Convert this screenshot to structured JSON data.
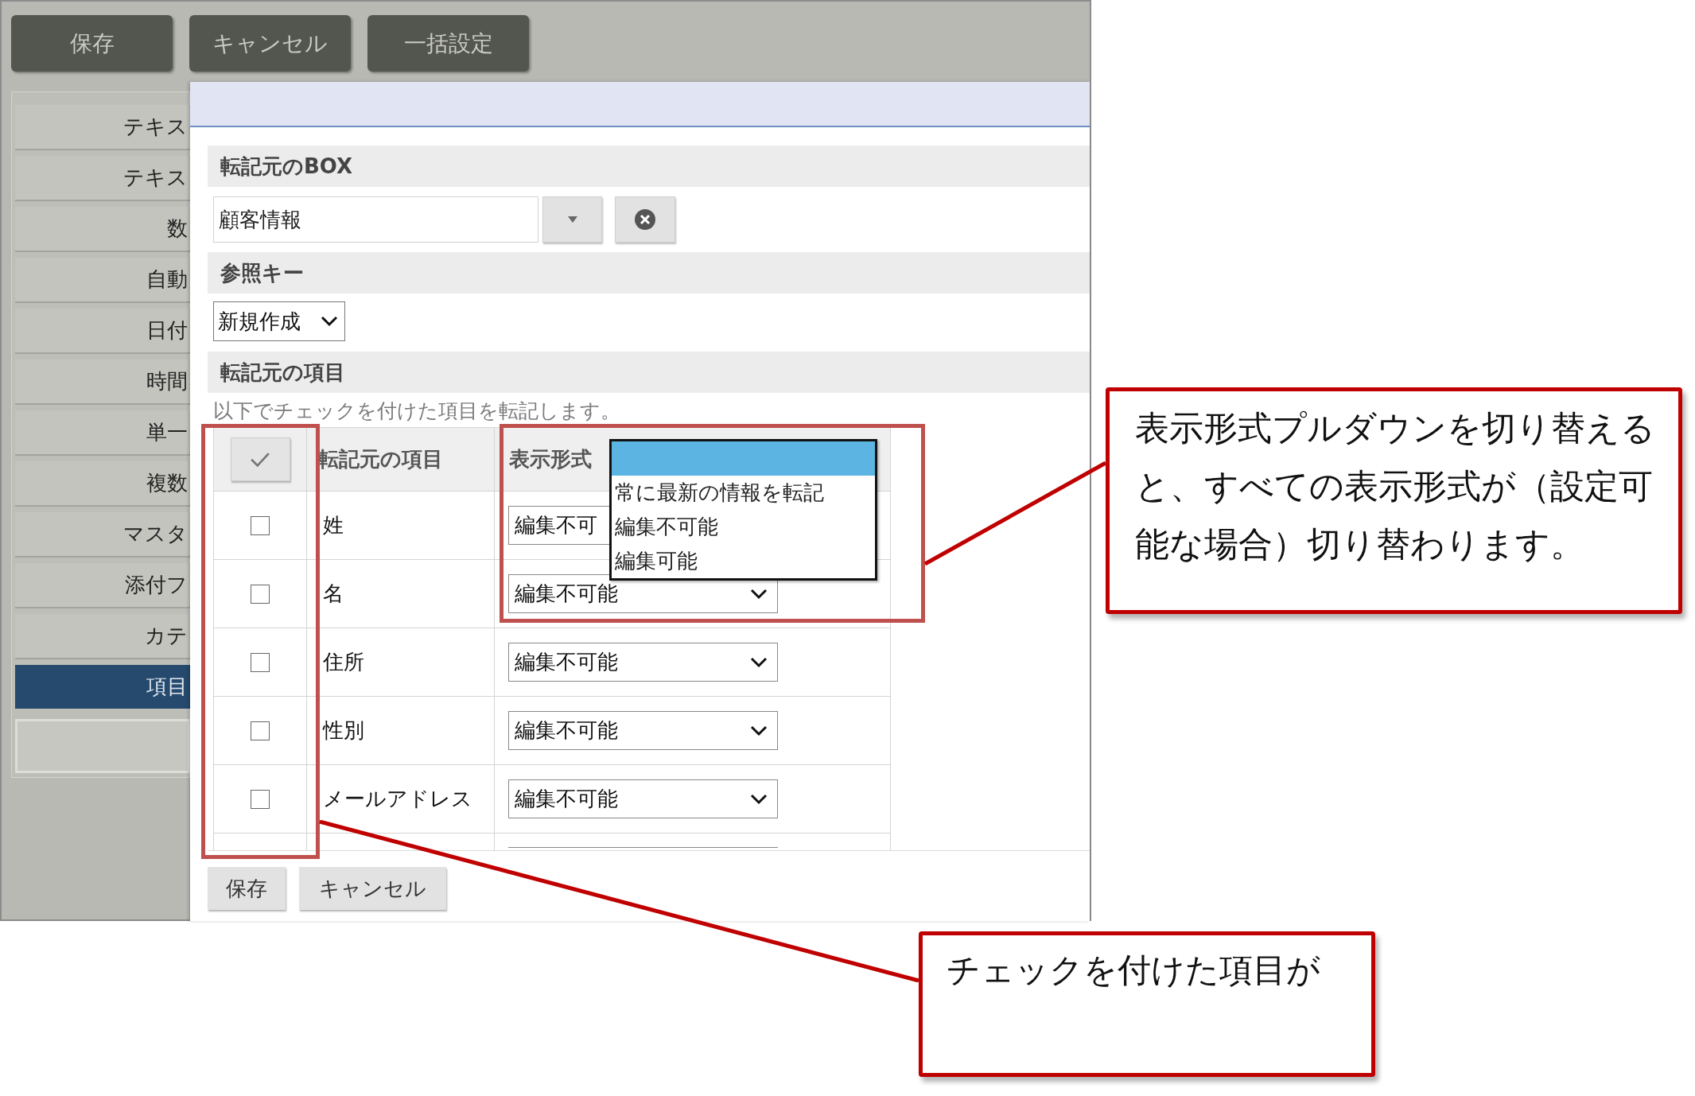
{
  "toolbar": {
    "buttons": [
      "保存",
      "キャンセル",
      "一括設定"
    ]
  },
  "sidebar": {
    "items": [
      {
        "label": "テキス",
        "selected": false
      },
      {
        "label": "テキス",
        "selected": false
      },
      {
        "label": "数",
        "selected": false
      },
      {
        "label": "自動",
        "selected": false
      },
      {
        "label": "日付",
        "selected": false
      },
      {
        "label": "時間",
        "selected": false
      },
      {
        "label": "単一",
        "selected": false
      },
      {
        "label": "複数",
        "selected": false
      },
      {
        "label": "マスタ",
        "selected": false
      },
      {
        "label": "添付フ",
        "selected": false
      },
      {
        "label": "カテ",
        "selected": false
      },
      {
        "label": "項目",
        "selected": true
      }
    ]
  },
  "dialog": {
    "source_box": {
      "heading": "転記元のBOX",
      "value": "顧客情報"
    },
    "reference_key": {
      "heading": "参照キー",
      "value": "新規作成"
    },
    "source_items": {
      "heading": "転記元の項目",
      "description": "以下でチェックを付けた項目を転記します。",
      "columns": [
        "転記元の項目",
        "表示形式"
      ],
      "rows": [
        {
          "checked": false,
          "item": "姓",
          "format": "編集不可",
          "expanded": true
        },
        {
          "checked": false,
          "item": "名",
          "format": "編集不可能",
          "expanded": false
        },
        {
          "checked": false,
          "item": "住所",
          "format": "編集不可能",
          "expanded": false
        },
        {
          "checked": false,
          "item": "性別",
          "format": "編集不可能",
          "expanded": false
        },
        {
          "checked": false,
          "item": "メールアドレス",
          "format": "編集不可能",
          "expanded": false
        }
      ],
      "format_menu": {
        "blank_option_highlighted": true,
        "options": [
          "常に最新の情報を転記",
          "編集不可能",
          "編集可能"
        ]
      }
    },
    "buttons": [
      "保存",
      "キャンセル"
    ]
  },
  "annotations": [
    {
      "text": "表示形式プルダウンを切り替えると、すべての表示形式が（設定可能な場合）切り替わります。"
    },
    {
      "text": "チェックを付けた項目が"
    }
  ]
}
